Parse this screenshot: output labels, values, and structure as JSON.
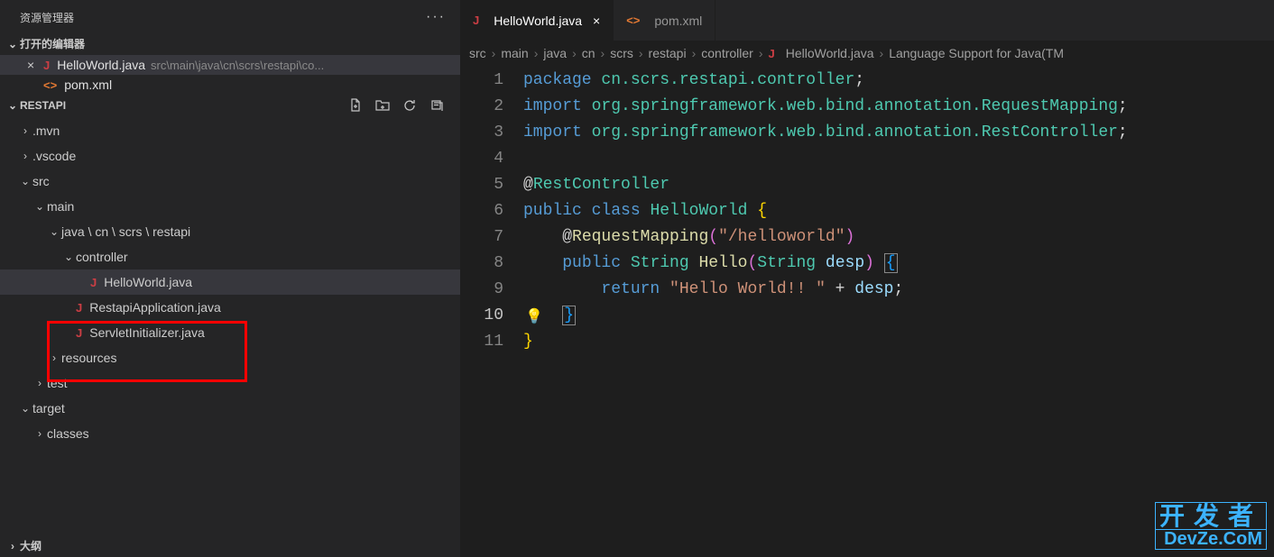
{
  "sidebar": {
    "title": "资源管理器",
    "openEditorsLabel": "打开的编辑器",
    "editors": [
      {
        "name": "HelloWorld.java",
        "path": "src\\main\\java\\cn\\scrs\\restapi\\co...",
        "iconType": "java",
        "active": true,
        "hasClose": true
      },
      {
        "name": "pom.xml",
        "path": "",
        "iconType": "xml",
        "active": false,
        "hasClose": false
      }
    ],
    "projectLabel": "RESTAPI",
    "outlineLabel": "大纲",
    "tree": [
      {
        "label": ".mvn",
        "indent": 1,
        "chev": "›"
      },
      {
        "label": ".vscode",
        "indent": 1,
        "chev": "›"
      },
      {
        "label": "src",
        "indent": 1,
        "chev": "⌄"
      },
      {
        "label": "main",
        "indent": 2,
        "chev": "⌄"
      },
      {
        "label": "java \\ cn \\ scrs \\ restapi",
        "indent": 3,
        "chev": "⌄"
      },
      {
        "label": "controller",
        "indent": 4,
        "chev": "⌄"
      },
      {
        "label": "HelloWorld.java",
        "indent": 5,
        "chev": "",
        "icon": "java",
        "selected": true
      },
      {
        "label": "RestapiApplication.java",
        "indent": 4,
        "chev": "",
        "icon": "java"
      },
      {
        "label": "ServletInitializer.java",
        "indent": 4,
        "chev": "",
        "icon": "java"
      },
      {
        "label": "resources",
        "indent": 3,
        "chev": "›"
      },
      {
        "label": "test",
        "indent": 2,
        "chev": "›"
      },
      {
        "label": "target",
        "indent": 1,
        "chev": "⌄"
      },
      {
        "label": "classes",
        "indent": 2,
        "chev": "›"
      }
    ]
  },
  "tabs": [
    {
      "name": "HelloWorld.java",
      "icon": "java",
      "active": true,
      "close": "×"
    },
    {
      "name": "pom.xml",
      "icon": "xml",
      "active": false,
      "close": ""
    }
  ],
  "breadcrumb": {
    "parts": [
      "src",
      "main",
      "java",
      "cn",
      "scrs",
      "restapi",
      "controller"
    ],
    "file": "HelloWorld.java",
    "tail": "Language Support for Java(TM"
  },
  "code": {
    "lines": [
      [
        {
          "t": "package ",
          "c": "keyword"
        },
        {
          "t": "cn.scrs.restapi.controller",
          "c": "type"
        },
        {
          "t": ";",
          "c": "punct"
        }
      ],
      [
        {
          "t": "import ",
          "c": "keyword"
        },
        {
          "t": "org.springframework.web.bind.annotation.RequestMapping",
          "c": "type"
        },
        {
          "t": ";",
          "c": "punct"
        }
      ],
      [
        {
          "t": "import ",
          "c": "keyword"
        },
        {
          "t": "org.springframework.web.bind.annotation.RestController",
          "c": "type"
        },
        {
          "t": ";",
          "c": "punct"
        }
      ],
      [],
      [
        {
          "t": "@",
          "c": "punct"
        },
        {
          "t": "RestController",
          "c": "type"
        }
      ],
      [
        {
          "t": "public class ",
          "c": "keyword"
        },
        {
          "t": "HelloWorld ",
          "c": "type"
        },
        {
          "t": "{",
          "c": "bracket1"
        }
      ],
      [
        {
          "t": "    ",
          "c": "default"
        },
        {
          "t": "@",
          "c": "punct"
        },
        {
          "t": "RequestMapping",
          "c": "annotation"
        },
        {
          "t": "(",
          "c": "bracket2"
        },
        {
          "t": "\"/helloworld\"",
          "c": "string"
        },
        {
          "t": ")",
          "c": "bracket2"
        }
      ],
      [
        {
          "t": "    ",
          "c": "default"
        },
        {
          "t": "public ",
          "c": "keyword"
        },
        {
          "t": "String ",
          "c": "type"
        },
        {
          "t": "Hello",
          "c": "method"
        },
        {
          "t": "(",
          "c": "bracket2"
        },
        {
          "t": "String ",
          "c": "type"
        },
        {
          "t": "desp",
          "c": "var"
        },
        {
          "t": ") ",
          "c": "bracket2"
        },
        {
          "t": "{",
          "c": "bracket3",
          "box": true
        }
      ],
      [
        {
          "t": "        ",
          "c": "default"
        },
        {
          "t": "return ",
          "c": "keyword"
        },
        {
          "t": "\"Hello World!! \"",
          "c": "string"
        },
        {
          "t": " + ",
          "c": "default"
        },
        {
          "t": "desp",
          "c": "var"
        },
        {
          "t": ";",
          "c": "punct"
        }
      ],
      [
        {
          "t": "    ",
          "c": "default"
        },
        {
          "t": "}",
          "c": "bracket3",
          "box": true
        }
      ],
      [
        {
          "t": "}",
          "c": "bracket1"
        }
      ]
    ],
    "currentLine": 10,
    "bulbLine": 10
  },
  "watermark": {
    "line1": "开发者",
    "line2": "DevZe.CoM"
  }
}
